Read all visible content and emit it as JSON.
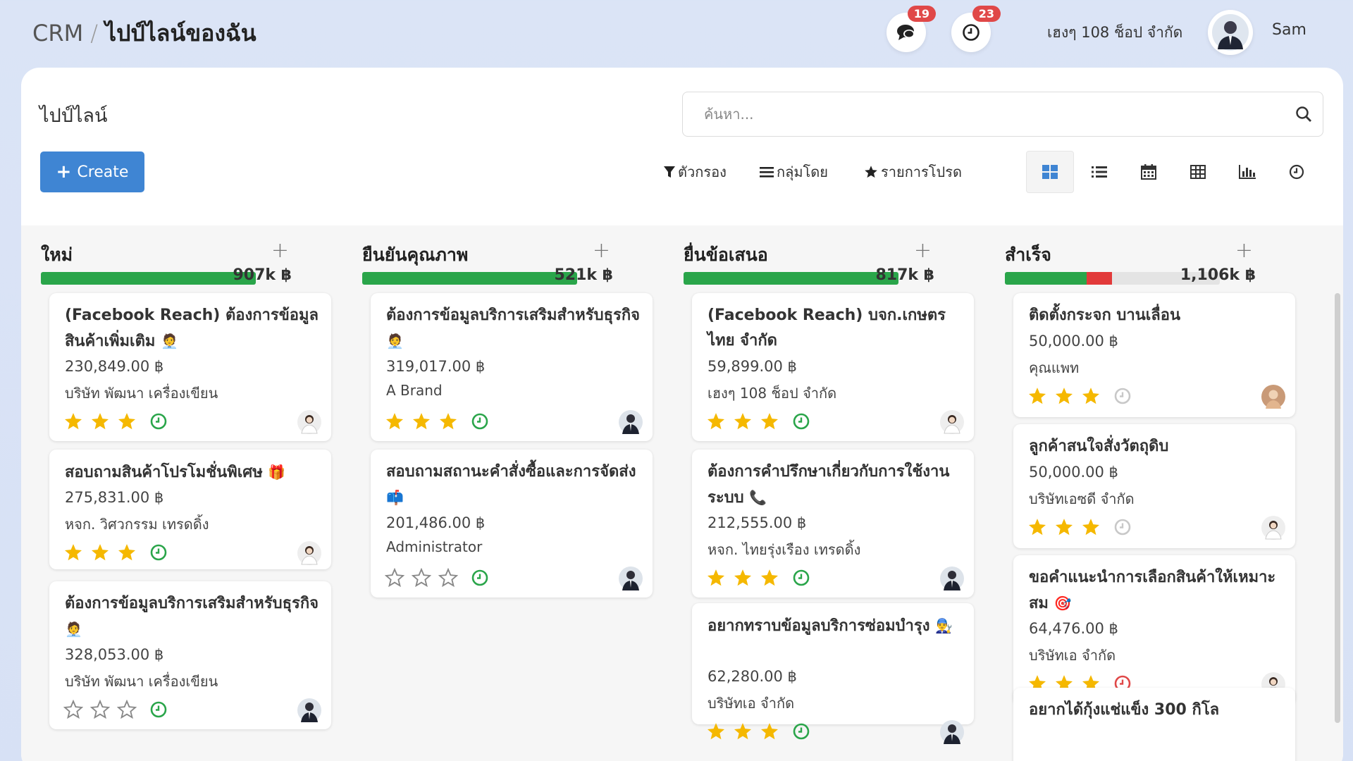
{
  "breadcrumb": {
    "root": "CRM",
    "separator": "/",
    "current": "ไปป์ไลน์ของฉัน"
  },
  "header": {
    "messages_badge": "19",
    "activities_badge": "23",
    "company": "เฮงๆ 108 ช็อป จำกัด",
    "username": "Sam"
  },
  "page": {
    "title": "ไปป์ไลน์",
    "search_placeholder": "ค้นหา...",
    "create_label": "Create",
    "filter_label": "ตัวกรอง",
    "groupby_label": "กลุ่มโดย",
    "favorites_label": "รายการโปรด"
  },
  "views": [
    "kanban-icon",
    "list-icon",
    "calendar-icon",
    "pivot-icon",
    "graph-icon",
    "activity-icon"
  ],
  "colors": {
    "accent": "#3f85d3",
    "progress_green": "#2aa54a",
    "progress_red": "#e23a3a",
    "star": "#f5b800",
    "clock_ok": "#2aa54a",
    "clock_late": "#e04848"
  },
  "columns": [
    {
      "title": "ใหม่",
      "total": "907k ฿",
      "progress": {
        "won": 1.0,
        "lost": 0
      },
      "cards": [
        {
          "title": "(Facebook Reach) ต้องการข้อมูลสินค้าเพิ่มเติม",
          "emoji": "🧑‍💼",
          "amount": "230,849.00 ฿",
          "customer": "บริษัท พัฒนา เครื่องเขียน",
          "stars": 3,
          "activity": "ok"
        },
        {
          "title": "สอบถามสินค้าโปรโมชั่นพิเศษ",
          "emoji": "🎁",
          "amount": "275,831.00 ฿",
          "customer": "หจก. วิศวกรรม เทรดดิ้ง",
          "stars": 3,
          "activity": "ok"
        },
        {
          "title": "ต้องการข้อมูลบริการเสริมสำหรับธุรกิจ",
          "emoji": "🧑‍💼",
          "amount": "328,053.00 ฿",
          "customer": "บริษัท พัฒนา เครื่องเขียน",
          "stars": 0,
          "activity": "ok"
        }
      ]
    },
    {
      "title": "ยืนยันคุณภาพ",
      "total": "521k ฿",
      "progress": {
        "won": 1.0,
        "lost": 0
      },
      "cards": [
        {
          "title": "ต้องการข้อมูลบริการเสริมสำหรับธุรกิจ",
          "emoji": "🧑‍💼",
          "amount": "319,017.00 ฿",
          "customer": "A Brand",
          "stars": 3,
          "activity": "ok"
        },
        {
          "title": "สอบถามสถานะคำสั่งซื้อและการจัดส่ง",
          "emoji": "📫",
          "amount": "201,486.00 ฿",
          "customer": "Administrator",
          "stars": 0,
          "activity": "ok"
        }
      ]
    },
    {
      "title": "ยื่นข้อเสนอ",
      "total": "817k ฿",
      "progress": {
        "won": 1.0,
        "lost": 0
      },
      "cards": [
        {
          "title": "(Facebook Reach) บจก.เกษตรไทย จำกัด",
          "emoji": "",
          "amount": "59,899.00 ฿",
          "customer": "เฮงๆ 108 ช็อป จำกัด",
          "stars": 3,
          "activity": "ok"
        },
        {
          "title": "ต้องการคำปรึกษาเกี่ยวกับการใช้งานระบบ",
          "emoji": "📞",
          "amount": "212,555.00 ฿",
          "customer": "หจก. ไทยรุ่งเรือง เทรดดิ้ง",
          "stars": 3,
          "activity": "ok"
        },
        {
          "title": "อยากทราบข้อมูลบริการซ่อมบำรุง",
          "emoji": "👨‍🔧",
          "amount": "62,280.00 ฿",
          "customer": "บริษัทเอ จำกัด",
          "stars": 3,
          "activity": "ok"
        }
      ]
    },
    {
      "title": "สำเร็จ",
      "total": "1,106k ฿",
      "progress": {
        "won": 0.38,
        "lost": 0.12
      },
      "cards": [
        {
          "title": "ติดตั้งกระจก บานเลื่อน",
          "emoji": "",
          "amount": "50,000.00 ฿",
          "customer": "คุณแพท",
          "stars": 3,
          "activity": "none"
        },
        {
          "title": "ลูกค้าสนใจสั่งวัตถุดิบ",
          "emoji": "",
          "amount": "50,000.00 ฿",
          "customer": "บริษัทเอซดี จำกัด",
          "stars": 3,
          "activity": "none"
        },
        {
          "title": "ขอคำแนะนำการเลือกสินค้าให้เหมาะสม",
          "emoji": "🎯",
          "amount": "64,476.00 ฿",
          "customer": "บริษัทเอ จำกัด",
          "stars": 3,
          "activity": "late"
        },
        {
          "title": "อยากได้กุ้งแช่แข็ง 300 กิโล",
          "emoji": "",
          "amount": "",
          "customer": "",
          "stars": 0,
          "activity": "none"
        }
      ]
    }
  ]
}
